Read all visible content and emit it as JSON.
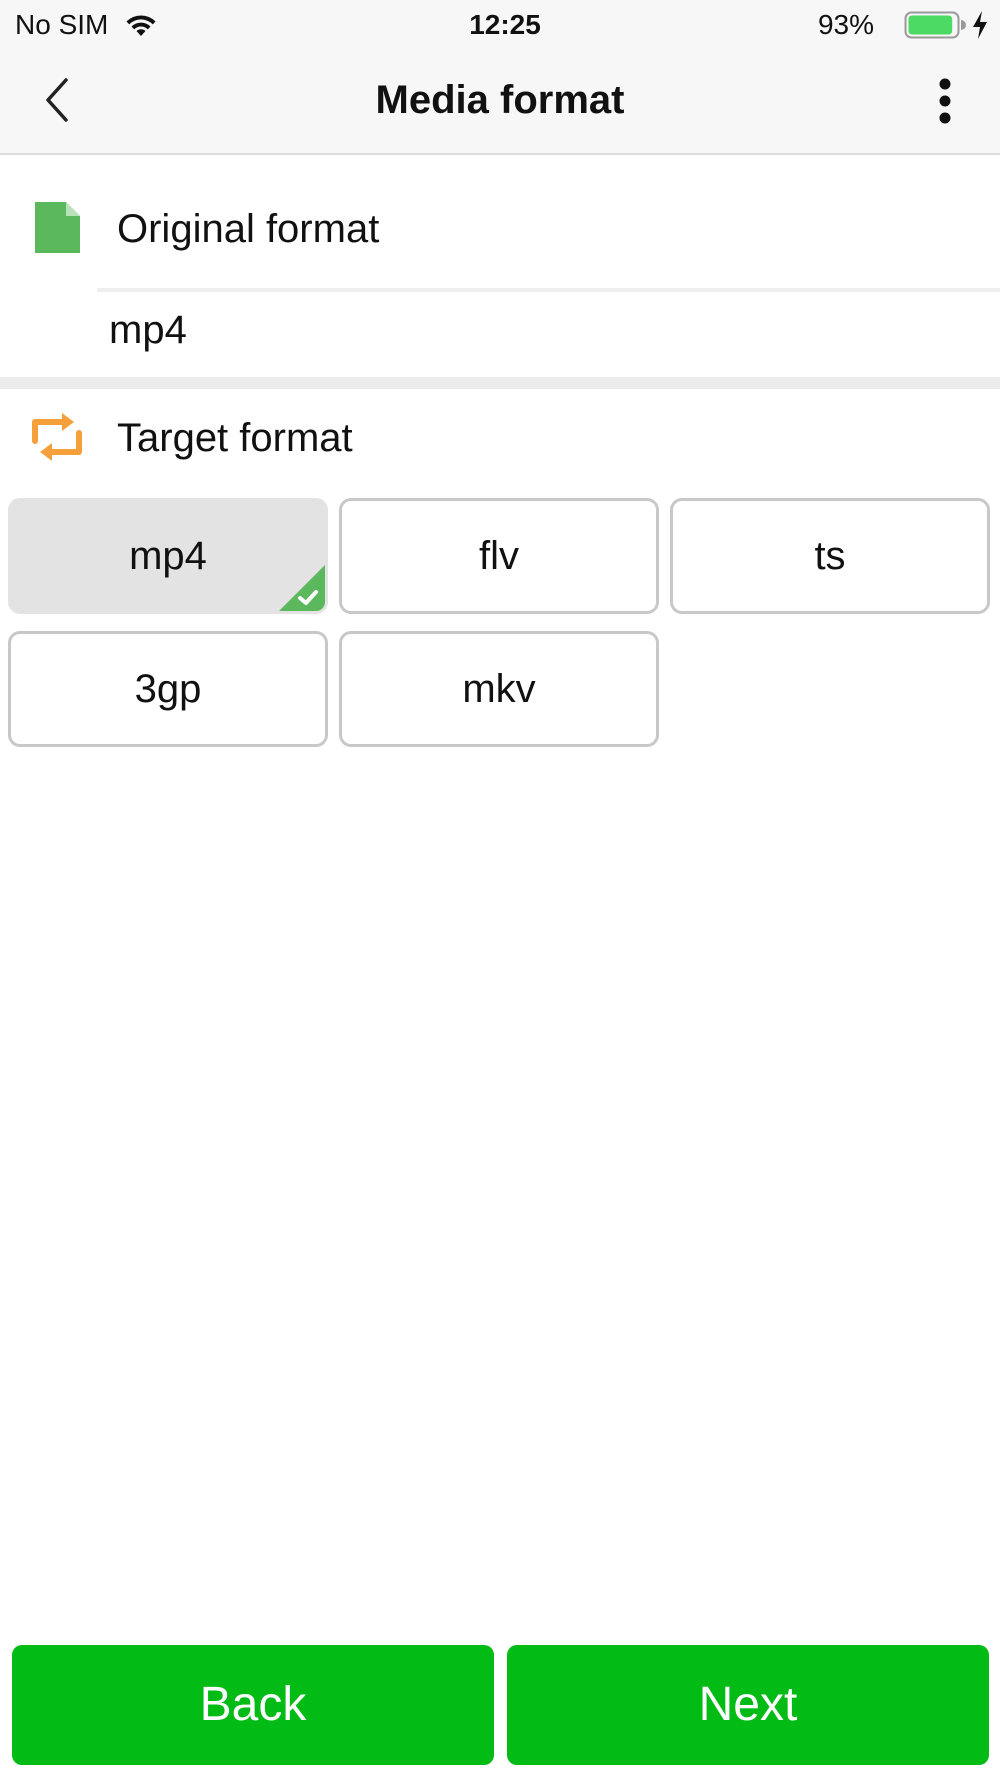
{
  "status_bar": {
    "carrier": "No SIM",
    "time": "12:25",
    "battery_percent": "93%",
    "battery_level": 0.93,
    "icons": [
      "wifi-icon",
      "battery-icon",
      "charging-bolt-icon"
    ]
  },
  "nav": {
    "title": "Media format",
    "back_icon": "chevron-left-icon",
    "more_icon": "more-vertical-icon"
  },
  "original": {
    "label": "Original format",
    "value": "mp4",
    "icon": "file-icon",
    "icon_color": "#5cb85c"
  },
  "target": {
    "label": "Target format",
    "icon": "convert-icon",
    "icon_color": "#f5a03a",
    "options": [
      {
        "label": "mp4",
        "selected": true
      },
      {
        "label": "flv",
        "selected": false
      },
      {
        "label": "ts",
        "selected": false
      },
      {
        "label": "3gp",
        "selected": false
      },
      {
        "label": "mkv",
        "selected": false
      }
    ],
    "selected_check_color": "#5cb85c"
  },
  "footer": {
    "back_label": "Back",
    "next_label": "Next",
    "button_color": "#02bb14"
  }
}
